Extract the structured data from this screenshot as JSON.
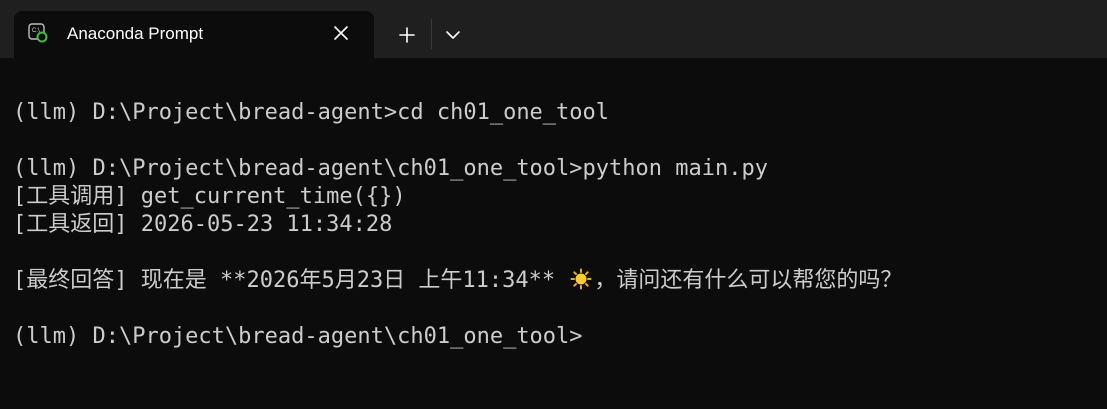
{
  "window": {
    "tab_title": "Anaconda Prompt",
    "tab_icon": "terminal-icon",
    "close_icon": "close-icon",
    "new_tab_icon": "plus-icon",
    "dropdown_icon": "chevron-down-icon"
  },
  "terminal": {
    "lines": [
      "(llm) D:\\Project\\bread-agent>cd ch01_one_tool",
      "(llm) D:\\Project\\bread-agent\\ch01_one_tool>python main.py",
      "[工具调用] get_current_time({})",
      "[工具返回] 2026-05-23 11:34:28",
      "[最终回答] 现在是 **2026年5月23日 上午11:34** ",
      "，请问还有什么可以帮您的吗？",
      "(llm) D:\\Project\\bread-agent\\ch01_one_tool>"
    ],
    "emoji": "sun-icon"
  },
  "colors": {
    "background": "#0c0c0c",
    "titlebar": "#1f1f1f",
    "text": "#cccccc"
  }
}
